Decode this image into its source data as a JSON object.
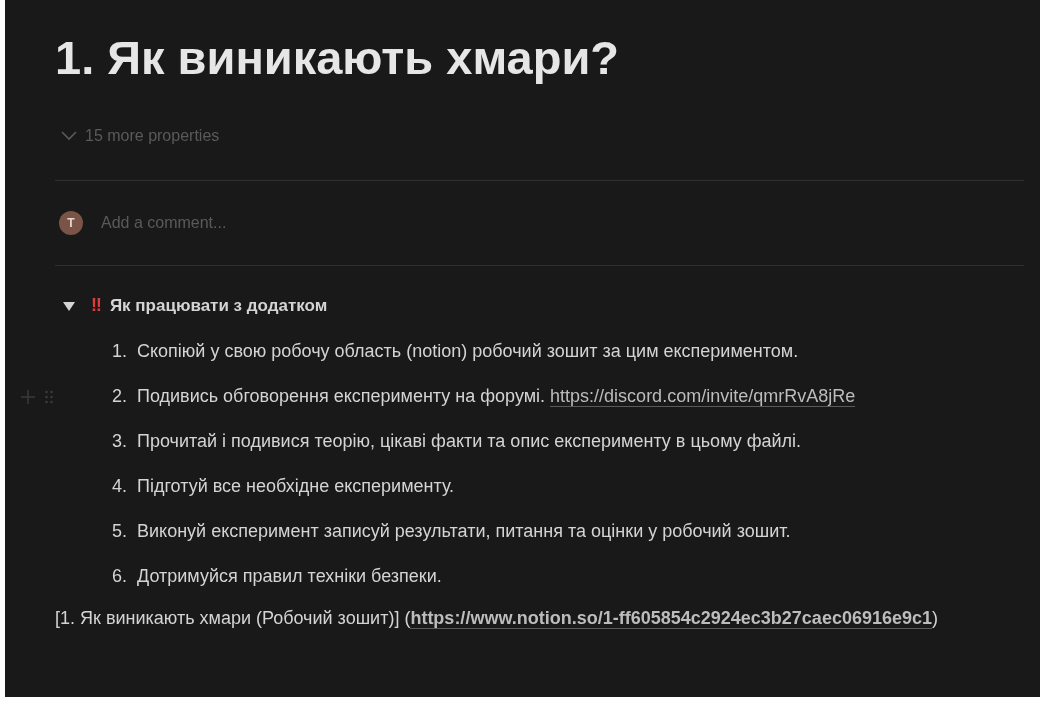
{
  "title": "1.  Як виникають хмари?",
  "properties_toggle": {
    "label": "15 more properties",
    "expanded": false
  },
  "comment": {
    "avatar_initial": "T",
    "placeholder": "Add a comment..."
  },
  "toggle": {
    "marker": "‼",
    "heading": "Як працювати з додатком",
    "expanded": true,
    "items": [
      {
        "number": "1.",
        "text": "Скопіюй у свою робочу область (notion) робочий зошит за цим експериментом.",
        "hovered": false
      },
      {
        "number": "2.",
        "text": "Подивись обговорення експерименту на форумі.",
        "link": "https://discord.com/invite/qmrRvA8jRe",
        "hovered": true
      },
      {
        "number": "3.",
        "text": "Прочитай і подивися теорію, цікаві факти та опис експерименту в цьому файлі.",
        "hovered": false
      },
      {
        "number": "4.",
        "text": "Підготуй все необхідне експерименту.",
        "hovered": false
      },
      {
        "number": "5.",
        "text": "Виконуй експеримент записуй результати, питання та оцінки у робочий зошит.",
        "hovered": false
      },
      {
        "number": "6.",
        "text": "Дотримуйся правил техніки безпеки.",
        "hovered": false
      }
    ]
  },
  "footer": {
    "text_before": "[1. Як виникають хмари (Робочий зошит)] (",
    "link": "https://www.notion.so/1-ff605854c2924ec3b27caec06916e9c1",
    "text_after": ")"
  }
}
